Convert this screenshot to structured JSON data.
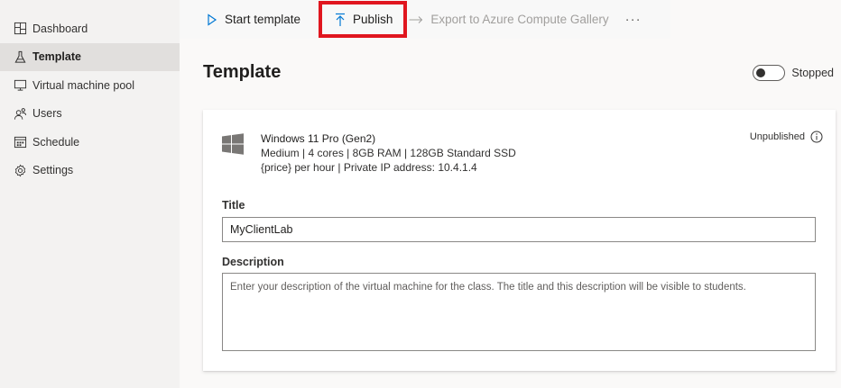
{
  "sidebar": {
    "items": [
      {
        "label": "Dashboard",
        "icon": "dashboard-icon"
      },
      {
        "label": "Template",
        "icon": "flask-icon",
        "active": true
      },
      {
        "label": "Virtual machine pool",
        "icon": "monitor-icon"
      },
      {
        "label": "Users",
        "icon": "users-icon"
      },
      {
        "label": "Schedule",
        "icon": "calendar-icon"
      },
      {
        "label": "Settings",
        "icon": "gear-icon"
      }
    ]
  },
  "toolbar": {
    "start_label": "Start template",
    "publish_label": "Publish",
    "export_label": "Export to Azure Compute Gallery",
    "more_label": "···"
  },
  "main": {
    "title": "Template",
    "toggle_state": "Stopped"
  },
  "vm": {
    "name": "Windows 11 Pro (Gen2)",
    "specs": "Medium | 4 cores | 8GB RAM | 128GB Standard SSD",
    "pricing": "{price} per hour | Private IP address: 10.4.1.4",
    "status": "Unpublished"
  },
  "form": {
    "title_label": "Title",
    "title_value": "MyClientLab",
    "description_label": "Description",
    "description_placeholder": "Enter your description of the virtual machine for the class. The title and this description will be visible to students."
  },
  "colors": {
    "highlight_border": "#e0161f",
    "sidebar_bg": "#f3f2f1",
    "active_item_bg": "#e1dfdd",
    "accent": "#0078d4"
  }
}
